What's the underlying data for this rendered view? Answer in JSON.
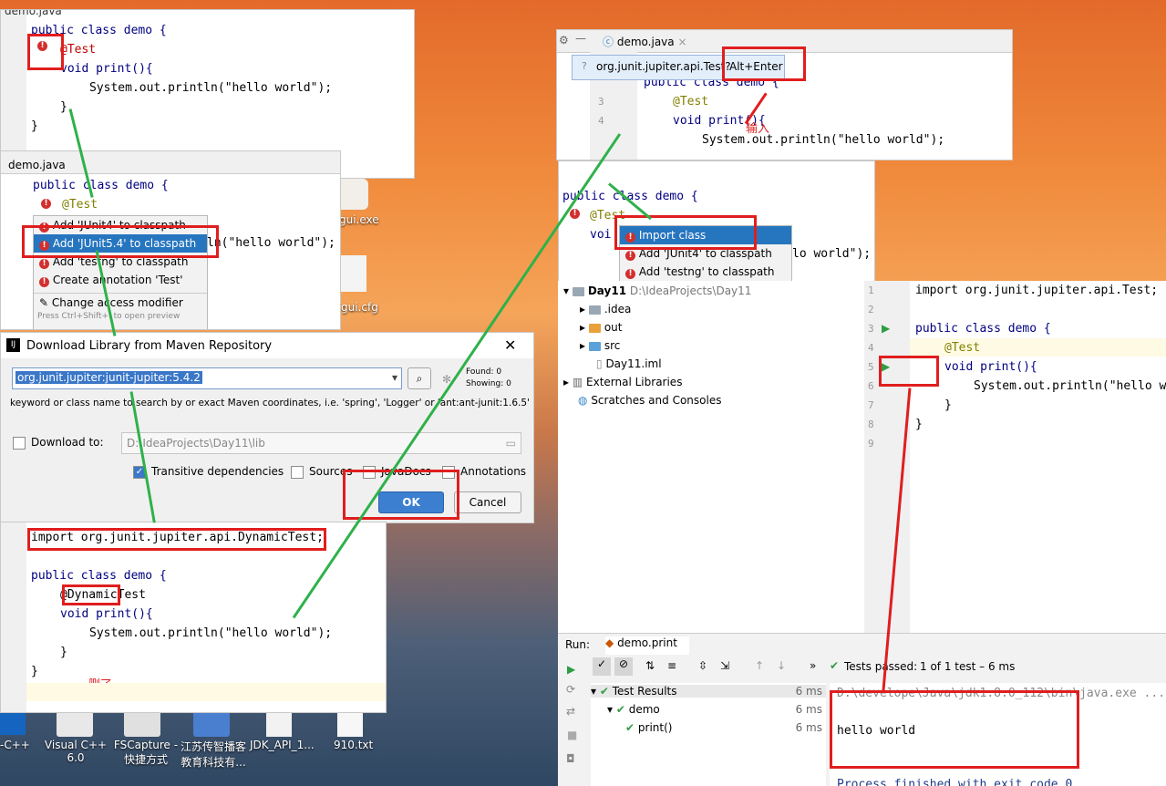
{
  "desktop": {
    "icons": [
      {
        "label": "gui.exe"
      },
      {
        "label": "gui.cfg"
      },
      {
        "label": "-C++"
      },
      {
        "label": "Visual C++ 6.0"
      },
      {
        "label": "FSCapture - 快捷方式"
      },
      {
        "label": "江苏传智播客教育科技有..."
      },
      {
        "label": "JDK_API_1..."
      },
      {
        "label": "910.txt"
      }
    ]
  },
  "editor1": {
    "tab": "demo.java",
    "lines": [
      "public class demo {",
      "@Test",
      "void print(){",
      "System.out.println(\"hello world\");",
      "}",
      "}"
    ]
  },
  "editor2": {
    "tab": "demo.java",
    "lines": [
      "public class demo {",
      "@Test"
    ],
    "menu": [
      "Add 'JUnit4' to classpath",
      "Add 'JUnit5.4' to classpath",
      "Add 'testng' to classpath",
      "Create annotation 'Test'",
      "Change access modifier"
    ],
    "menu_hint": "Press Ctrl+Shift+I to open preview",
    "code_tail": "ln(\"hello world\");"
  },
  "maven_dialog": {
    "title": "Download Library from Maven Repository",
    "query": "org.junit.jupiter:junit-jupiter:5.4.2",
    "found": "Found: 0",
    "showing": "Showing: 0",
    "hint": "keyword or class name to search by or exact Maven coordinates, i.e. 'spring', 'Logger' or 'ant:ant-junit:1.6.5'",
    "download_to_label": "Download to:",
    "download_path": "D:\\IdeaProjects\\Day11\\lib",
    "transitive": "Transitive dependencies",
    "sources": "Sources",
    "javadocs": "JavaDocs",
    "annotations": "Annotations",
    "ok": "OK",
    "cancel": "Cancel"
  },
  "editor3": {
    "import_line": "import org.junit.jupiter.api.DynamicTest;",
    "lines": [
      "public class demo {",
      "@DynamicTest",
      "void print(){",
      "System.out.println(\"hello world\");",
      "}",
      "}"
    ],
    "note": "删了"
  },
  "editor4": {
    "tab": "demo.java",
    "popup_text": "org.junit.jupiter.api.Test?",
    "popup_shortcut": "Alt+Enter",
    "line_numbers": [
      "3",
      "4"
    ],
    "lines": [
      "public class demo {",
      "@Test",
      "void print(){",
      "System.out.println(\"hello world\");"
    ],
    "note": "输入"
  },
  "editor5": {
    "lines": [
      "public class demo {",
      "@Test",
      "voi"
    ],
    "menu": [
      "Import class",
      "Add 'JUnit4' to classpath",
      "Add 'testng' to classpath"
    ],
    "code_tail": "lo world\");"
  },
  "project": {
    "root": "Day11",
    "root_path": "D:\\IdeaProjects\\Day11",
    "items": [
      ".idea",
      "out",
      "src",
      "Day11.iml",
      "External Libraries",
      "Scratches and Consoles"
    ]
  },
  "main_editor": {
    "line_numbers": [
      "1",
      "2",
      "3",
      "4",
      "5",
      "6",
      "7",
      "8",
      "9"
    ],
    "lines": [
      "import org.junit.jupiter.api.Test;",
      "",
      "public class demo {",
      "@Test",
      "void print(){",
      "System.out.println(\"hello w",
      "}",
      "}",
      ""
    ]
  },
  "run": {
    "label": "Run:",
    "config": "demo.print",
    "status": "Tests passed:",
    "status_count": "1 of 1 test – 6 ms",
    "tree": [
      {
        "name": "Test Results",
        "time": "6 ms"
      },
      {
        "name": "demo",
        "time": "6 ms"
      },
      {
        "name": "print()",
        "time": "6 ms"
      }
    ],
    "console": [
      "D:\\develope\\Java\\jdk1.8.0_112\\bin\\java.exe ...",
      "hello world",
      "Process finished with exit code 0"
    ]
  }
}
